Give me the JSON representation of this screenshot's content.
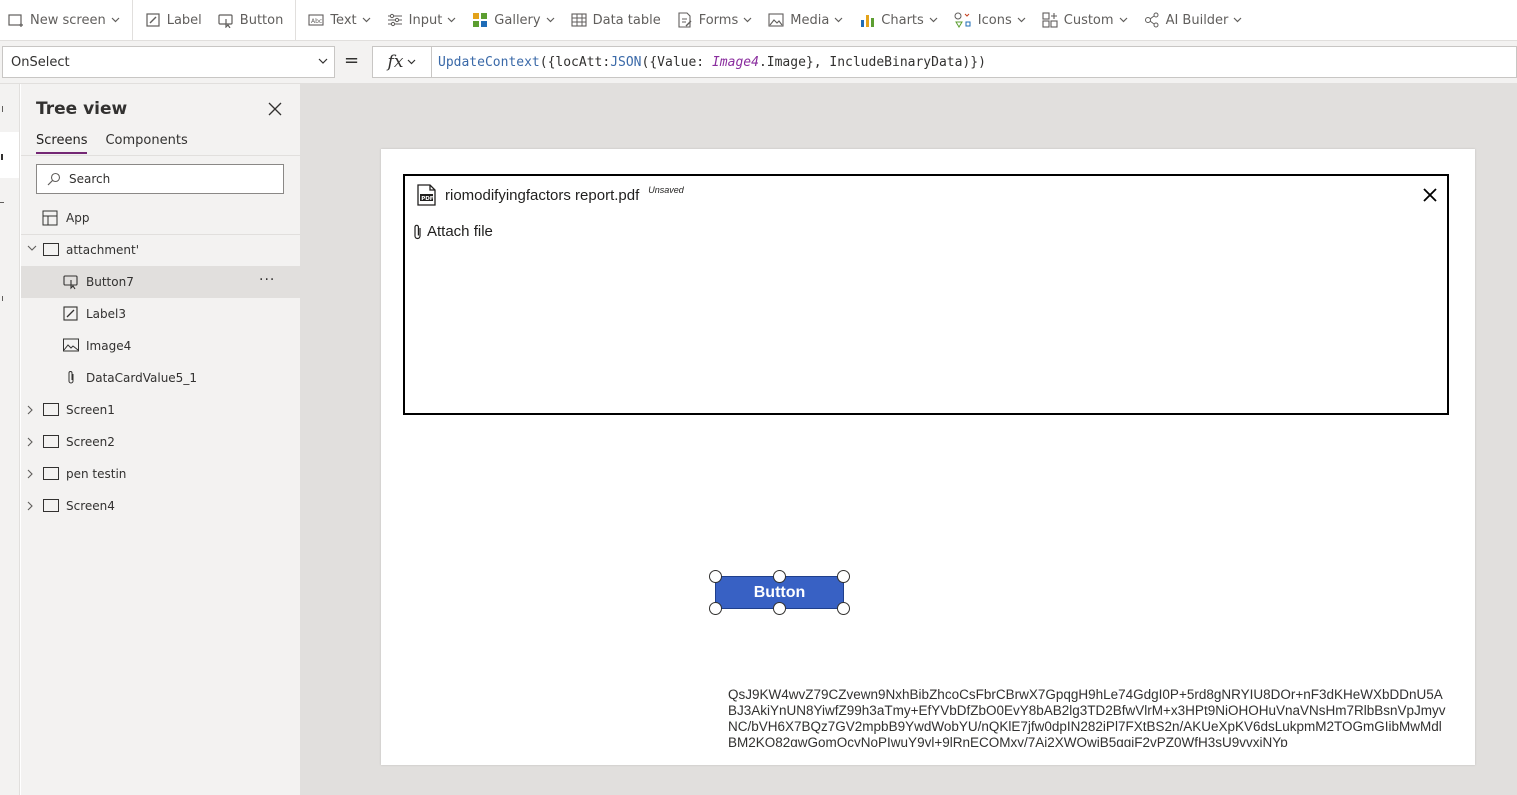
{
  "toolbar": {
    "items": [
      {
        "key": "new_screen",
        "label": "New screen",
        "icon": "new-screen-icon"
      },
      {
        "key": "label",
        "label": "Label",
        "icon": "label-icon"
      },
      {
        "key": "button",
        "label": "Button",
        "icon": "button-icon"
      },
      {
        "key": "text",
        "label": "Text",
        "icon": "text-icon"
      },
      {
        "key": "input",
        "label": "Input",
        "icon": "input-icon"
      },
      {
        "key": "gallery",
        "label": "Gallery",
        "icon": "gallery-icon"
      },
      {
        "key": "data_table",
        "label": "Data table",
        "icon": "data-table-icon"
      },
      {
        "key": "forms",
        "label": "Forms",
        "icon": "forms-icon"
      },
      {
        "key": "media",
        "label": "Media",
        "icon": "media-icon"
      },
      {
        "key": "charts",
        "label": "Charts",
        "icon": "charts-icon"
      },
      {
        "key": "icons",
        "label": "Icons",
        "icon": "icons-icon"
      },
      {
        "key": "custom",
        "label": "Custom",
        "icon": "custom-icon"
      },
      {
        "key": "ai_builder",
        "label": "AI Builder",
        "icon": "ai-builder-icon"
      }
    ]
  },
  "formula_bar": {
    "property": "OnSelect",
    "equals": "=",
    "fx": "fx",
    "formula": {
      "p1": "UpdateContext",
      "p2": "({locAtt:",
      "p3": "JSON",
      "p4": "({Value: ",
      "p5": "Image4",
      "p6": ".Image}, IncludeBinaryData)})"
    }
  },
  "tree_view": {
    "title": "Tree view",
    "tabs": {
      "screens": "Screens",
      "components": "Components"
    },
    "search_placeholder": "Search",
    "app": "App",
    "nodes": {
      "attachment": "attachment'",
      "button7": "Button7",
      "label3": "Label3",
      "image4": "Image4",
      "datacard": "DataCardValue5_1",
      "screen1": "Screen1",
      "screen2": "Screen2",
      "pen_testin": "pen testin",
      "screen4": "Screen4"
    },
    "more": "···"
  },
  "canvas": {
    "attachment": {
      "file_name": "riomodifyingfactors report.pdf",
      "status": "Unsaved",
      "attach_link": "Attach file"
    },
    "button_label": "Button",
    "base64_text": "QsJ9KW4wvZ79CZvewn9NxhBibZhcoCsFbrCBrwX7GpqgH9hLe74GdgI0P+5rd8gNRYIU8DOr+nF3dKHeWXbDDnU5ABJ3AkiYnUN8YiwfZ99h3aTmy+EfYVbDfZbO0EvY8bAB2lg3TD2BfwVlrM+x3HPt9NiOHOHuVnaVNsHm7RlbBsnVpJmyvNC/bVH6X7BQz7GV2mpbB9YwdWobYU/nQKlE7jfw0dpIN282iPl7FXtBS2n/AKUeXpKV6dsLukpmM2TOGmGIibMwMdlBM2KO82gwGomOcyNoPIwuY9yl+9lRnECOMxy/7Ai2XWOwiB5ggiF2vPZ0WfH3sU9vvxiNYp"
  },
  "colors": {
    "accent": "#742774",
    "button_fill": "#3861c4",
    "canvas_bg": "#e1dfdd"
  }
}
